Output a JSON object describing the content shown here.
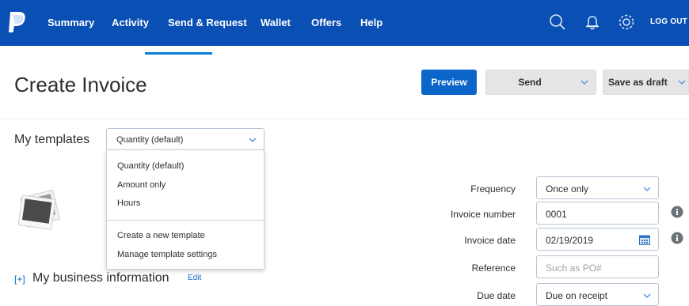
{
  "nav": {
    "items": [
      "Summary",
      "Activity",
      "Send & Request",
      "Wallet",
      "Offers",
      "Help"
    ],
    "logout": "LOG OUT",
    "icons": [
      "search-icon",
      "bell-icon",
      "gear-icon"
    ]
  },
  "header": {
    "title": "Create Invoice",
    "preview_label": "Preview",
    "send_label": "Send",
    "save_draft_label": "Save as draft"
  },
  "templates": {
    "label": "My templates",
    "selected": "Quantity (default)",
    "options": [
      "Quantity (default)",
      "Amount only",
      "Hours"
    ],
    "actions": [
      "Create a new template",
      "Manage template settings"
    ]
  },
  "business": {
    "toggle": "[+]",
    "label": "My business information",
    "edit": "Edit"
  },
  "form": {
    "frequency": {
      "label": "Frequency",
      "value": "Once only"
    },
    "invoice_number": {
      "label": "Invoice number",
      "value": "0001"
    },
    "invoice_date": {
      "label": "Invoice date",
      "value": "02/19/2019"
    },
    "reference": {
      "label": "Reference",
      "placeholder": "Such as PO#"
    },
    "due_date": {
      "label": "Due date",
      "value": "Due on receipt"
    }
  },
  "colors": {
    "nav_bg": "#0a4fb3",
    "primary_button": "#0c66c9",
    "link": "#0c66c9"
  }
}
